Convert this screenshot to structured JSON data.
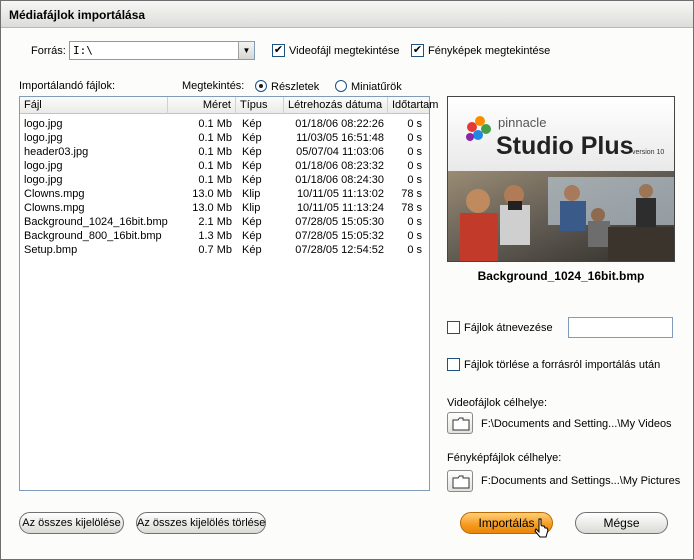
{
  "window": {
    "title": "Médiafájlok importálása"
  },
  "source": {
    "label": "Forrás:",
    "value": "I:\\",
    "video_preview_label": "Videofájl megtekintése",
    "video_preview_checked": true,
    "photo_preview_label": "Fényképek megtekintése",
    "photo_preview_checked": true
  },
  "files": {
    "section_label": "Importálandó fájlok:",
    "view_label": "Megtekintés:",
    "view_details_label": "Részletek",
    "view_thumbs_label": "Miniatűrök",
    "view_selected": "details",
    "columns": [
      "Fájl",
      "Méret",
      "Típus",
      "Létrehozás dátuma",
      "Időtartam"
    ],
    "rows": [
      {
        "name": "logo.jpg",
        "size": "0.1 Mb",
        "type": "Kép",
        "date": "01/18/06 08:22:26",
        "duration": "0 s"
      },
      {
        "name": "logo.jpg",
        "size": "0.1 Mb",
        "type": "Kép",
        "date": "11/03/05 16:51:48",
        "duration": "0 s"
      },
      {
        "name": "header03.jpg",
        "size": "0.1 Mb",
        "type": "Kép",
        "date": "05/07/04 11:03:06",
        "duration": "0 s"
      },
      {
        "name": "logo.jpg",
        "size": "0.1 Mb",
        "type": "Kép",
        "date": "01/18/06 08:23:32",
        "duration": "0 s"
      },
      {
        "name": "logo.jpg",
        "size": "0.1 Mb",
        "type": "Kép",
        "date": "01/18/06 08:24:30",
        "duration": "0 s"
      },
      {
        "name": "Clowns.mpg",
        "size": "13.0 Mb",
        "type": "Klip",
        "date": "10/11/05 11:13:02",
        "duration": "78 s"
      },
      {
        "name": "Clowns.mpg",
        "size": "13.0 Mb",
        "type": "Klip",
        "date": "10/11/05 11:13:24",
        "duration": "78 s"
      },
      {
        "name": "Background_1024_16bit.bmp",
        "size": "2.1 Mb",
        "type": "Kép",
        "date": "07/28/05 15:05:30",
        "duration": "0 s"
      },
      {
        "name": "Background_800_16bit.bmp",
        "size": "1.3 Mb",
        "type": "Kép",
        "date": "07/28/05 15:05:32",
        "duration": "0 s"
      },
      {
        "name": "Setup.bmp",
        "size": "0.7 Mb",
        "type": "Kép",
        "date": "07/28/05 12:54:52",
        "duration": "0 s"
      }
    ]
  },
  "preview": {
    "brand": "pinnacle",
    "product": "Studio Plus",
    "version": "version 10",
    "filename": "Background_1024_16bit.bmp"
  },
  "options": {
    "rename_label": "Fájlok átnevezése",
    "rename_checked": false,
    "rename_value": "",
    "delete_label": "Fájlok törlése a forrásról importálás után",
    "delete_checked": false
  },
  "destinations": {
    "video_label": "Videofájlok célhelye:",
    "video_path": "F:\\Documents and Setting...\\My Videos",
    "photo_label": "Fényképfájlok célhelye:",
    "photo_path": "F:Documents and Settings...\\My Pictures"
  },
  "buttons": {
    "select_all": "Az összes kijelölése",
    "clear_all": "Az összes kijelölés törlése",
    "import": "Importálás",
    "cancel": "Mégse"
  },
  "colors": {
    "accent": "#f59a1c",
    "border": "#7f9db9"
  },
  "icons": {
    "dropdown": "chevron-down-icon",
    "folder": "folder-icon",
    "cursor": "mouse-cursor-icon"
  }
}
